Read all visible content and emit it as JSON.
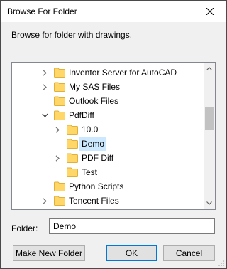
{
  "window": {
    "title": "Browse For Folder",
    "close_icon": "close-icon"
  },
  "description": "Browse for folder with drawings.",
  "tree": {
    "items": [
      {
        "label": "Inventor Server for AutoCAD",
        "level": 0,
        "expander": "collapsed",
        "selected": false
      },
      {
        "label": "My SAS Files",
        "level": 0,
        "expander": "collapsed",
        "selected": false
      },
      {
        "label": "Outlook Files",
        "level": 0,
        "expander": "none",
        "selected": false
      },
      {
        "label": "PdfDiff",
        "level": 0,
        "expander": "expanded",
        "selected": false
      },
      {
        "label": "10.0",
        "level": 1,
        "expander": "collapsed",
        "selected": false
      },
      {
        "label": "Demo",
        "level": 1,
        "expander": "none",
        "selected": true
      },
      {
        "label": "PDF Diff",
        "level": 1,
        "expander": "collapsed",
        "selected": false
      },
      {
        "label": "Test",
        "level": 1,
        "expander": "none",
        "selected": false
      },
      {
        "label": "Python Scripts",
        "level": 0,
        "expander": "none",
        "selected": false
      },
      {
        "label": "Tencent Files",
        "level": 0,
        "expander": "collapsed",
        "selected": false
      }
    ]
  },
  "folder_field": {
    "label": "Folder:",
    "value": "Demo"
  },
  "buttons": {
    "make_new": "Make New Folder",
    "ok": "OK",
    "cancel": "Cancel"
  },
  "colors": {
    "selection": "#cce8ff",
    "focus_border": "#0078d7",
    "folder_fill": "#ffd769",
    "folder_edge": "#e0b03a"
  }
}
